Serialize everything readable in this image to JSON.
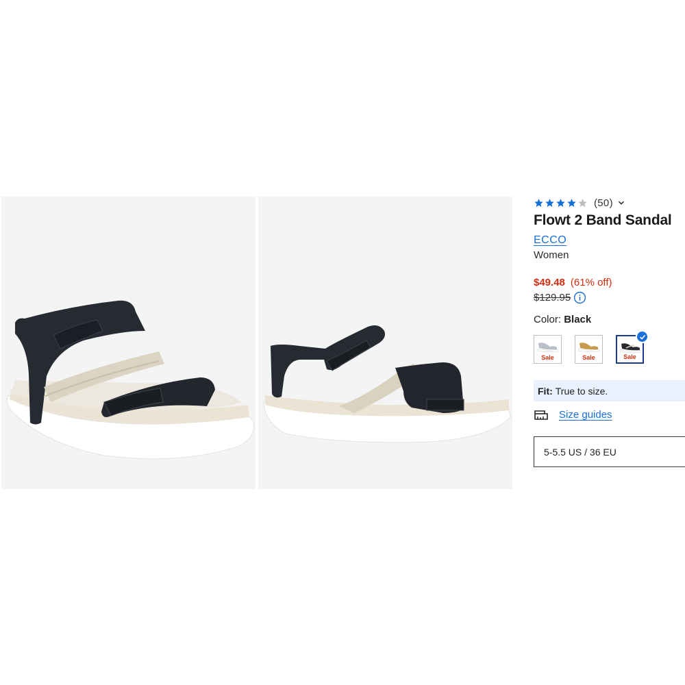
{
  "product": {
    "rating_count": "(50)",
    "rating_value": 4,
    "rating_max": 5,
    "title": "Flowt 2 Band Sandal",
    "brand": "ECCO",
    "audience": "Women",
    "sale_price": "$49.48",
    "discount": "(61% off)",
    "original_price": "$129.95",
    "color_label": "Color:",
    "color_value": "Black"
  },
  "swatches": [
    {
      "name": "silver",
      "sale_label": "Sale",
      "selected": false
    },
    {
      "name": "gold",
      "sale_label": "Sale",
      "selected": false
    },
    {
      "name": "black",
      "sale_label": "Sale",
      "selected": true
    }
  ],
  "fit": {
    "label": "Fit:",
    "text": "True to size."
  },
  "size_guides": {
    "label": "Size guides"
  },
  "size_select": {
    "value": "5-5.5 US / 36 EU"
  },
  "colors": {
    "accent": "#1a6fd8",
    "sale_red": "#d12e0f",
    "fit_bg": "#e8f1fd",
    "star": "#1a6fd8"
  }
}
